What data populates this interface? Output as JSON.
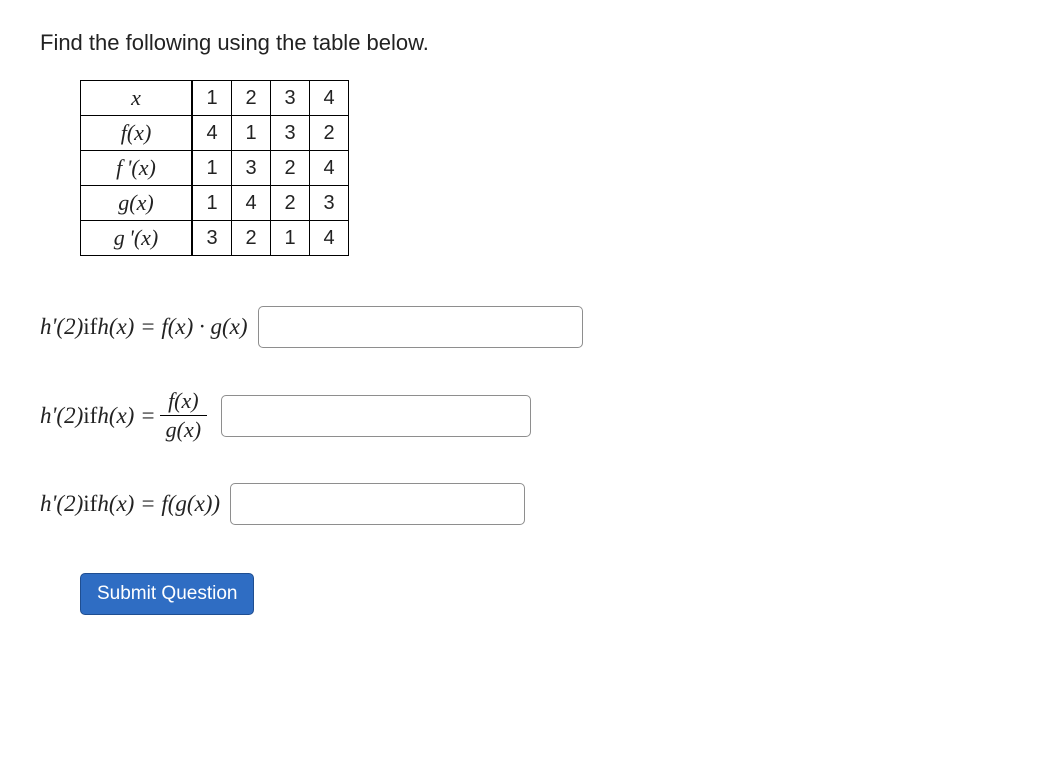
{
  "prompt": "Find the following using the table below.",
  "table": {
    "rows": [
      {
        "label": "x",
        "c1": "1",
        "c2": "2",
        "c3": "3",
        "c4": "4"
      },
      {
        "label": "f(x)",
        "c1": "4",
        "c2": "1",
        "c3": "3",
        "c4": "2"
      },
      {
        "label": "f '(x)",
        "c1": "1",
        "c2": "3",
        "c3": "2",
        "c4": "4"
      },
      {
        "label": "g(x)",
        "c1": "1",
        "c2": "4",
        "c3": "2",
        "c4": "3"
      },
      {
        "label": "g '(x)",
        "c1": "3",
        "c2": "2",
        "c3": "1",
        "c4": "4"
      }
    ]
  },
  "questions": {
    "q1": {
      "hprime": "h'(2)",
      "if": " if ",
      "hdef": "h(x) = f(x) · g(x)"
    },
    "q2": {
      "hprime": "h'(2)",
      "if": " if ",
      "hdef_prefix": "h(x) = ",
      "frac_num": "f(x)",
      "frac_den": "g(x)"
    },
    "q3": {
      "hprime": "h'(2)",
      "if": " if ",
      "hdef": "h(x) = f(g(x))"
    }
  },
  "submit_label": "Submit Question"
}
